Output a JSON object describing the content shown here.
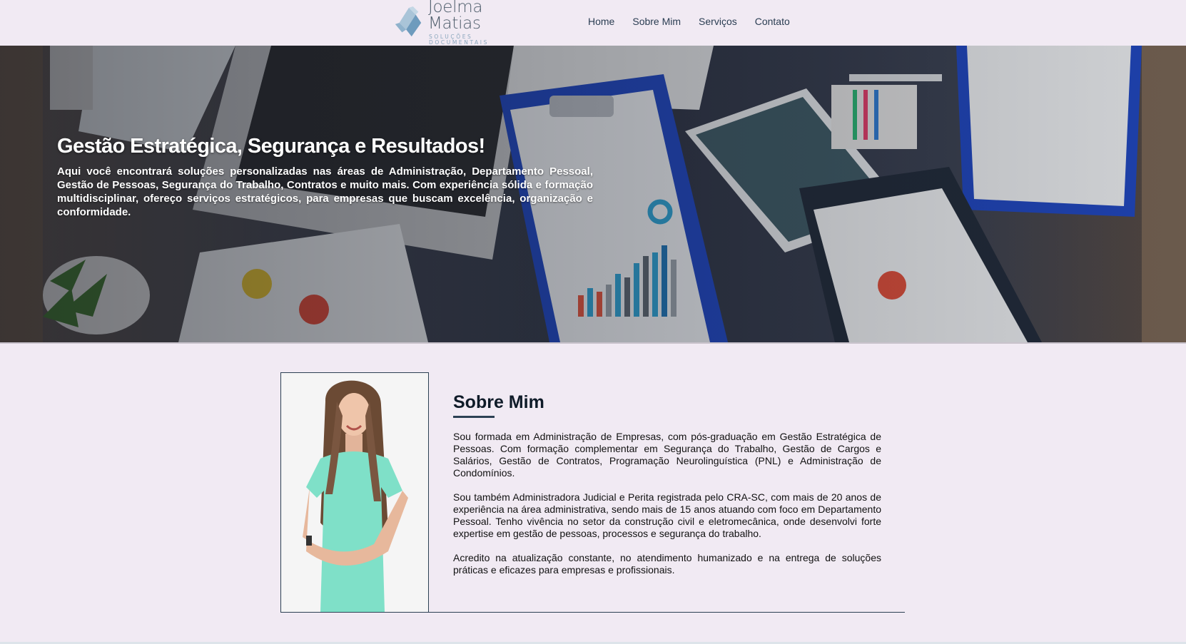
{
  "header": {
    "logo": {
      "name": "Joelma Matias",
      "subtitle": "SOLUÇÕES DOCUMENTAIS",
      "icon": "diamond-logo-icon",
      "colors": {
        "primary": "#6e9bbd",
        "light": "#a9c4d8",
        "text": "#4e5d6b"
      }
    },
    "nav": [
      {
        "label": "Home"
      },
      {
        "label": "Sobre Mim"
      },
      {
        "label": "Serviços"
      },
      {
        "label": "Contato"
      }
    ]
  },
  "hero": {
    "title": "Gestão Estratégica, Segurança e Resultados!",
    "text": "Aqui você encontrará soluções personalizadas nas áreas de Administração, Departamento Pessoal, Gestão de Pessoas, Segurança do Trabalho, Contratos e muito mais. Com experiência sólida e formação multidisciplinar, ofereço serviços estratégicos, para empresas que buscam excelência, organização e conformidade."
  },
  "about": {
    "title": "Sobre Mim",
    "paragraphs": [
      "Sou formada em Administração de Empresas, com pós-graduação em Gestão Estratégica de Pessoas. Com formação complementar em Segurança do Trabalho, Gestão de Cargos e Salários, Gestão de Contratos, Programação Neurolinguística (PNL) e Administração de Condomínios.",
      "Sou também Administradora Judicial e Perita registrada pelo CRA-SC, com mais de 20 anos de experiência na área administrativa, sendo mais de 15 anos atuando com foco em Departamento Pessoal. Tenho vivência no setor da construção civil e eletromecânica, onde desenvolvi forte expertise em gestão de pessoas, processos e segurança do trabalho.",
      "Acredito na atualização constante, no atendimento humanizado e na entrega de soluções práticas e eficazes para empresas e profissionais."
    ]
  },
  "colors": {
    "page_bg": "#f1eaf3",
    "nav_text": "#2a3d52",
    "accent": "#2c4053",
    "outfit": "#7fe0c8"
  }
}
